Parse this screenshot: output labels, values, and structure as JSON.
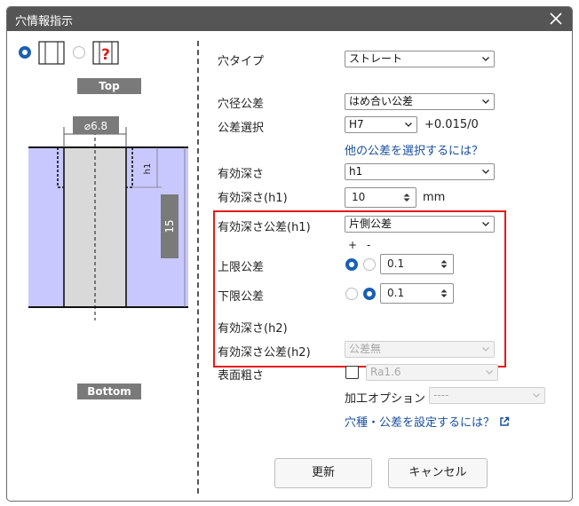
{
  "window": {
    "title": "穴情報指示"
  },
  "left": {
    "top_label": "Top",
    "bottom_label": "Bottom",
    "diagram": {
      "diameter": "⌀6.8",
      "depth_label": "h1",
      "depth_value": "15"
    }
  },
  "form": {
    "hole_type": {
      "label": "穴タイプ",
      "value": "ストレート"
    },
    "dia_tol": {
      "label": "穴径公差",
      "value": "はめ合い公差"
    },
    "tol_select": {
      "label": "公差選択",
      "value": "H7",
      "range": "+0.015/0"
    },
    "other_tol_link": "他の公差を選択するには？",
    "eff_depth": {
      "label": "有効深さ",
      "value": "h1"
    },
    "eff_depth_h1": {
      "label": "有効深さ(h1)",
      "value": "10",
      "unit": "mm"
    },
    "eff_depth_tol_h1": {
      "label": "有効深さ公差(h1)",
      "value": "片側公差"
    },
    "sign_plus": "+",
    "sign_minus": "-",
    "upper_tol": {
      "label": "上限公差",
      "value": "0.1"
    },
    "lower_tol": {
      "label": "下限公差",
      "value": "0.1"
    },
    "eff_depth_h2": {
      "label": "有効深さ(h2)"
    },
    "eff_depth_tol_h2": {
      "label": "有効深さ公差(h2)",
      "value": "公差無"
    },
    "surface": {
      "label": "表面粗さ",
      "value": "Ra1.6"
    },
    "process_option": {
      "label": "加工オプション",
      "value": "----"
    },
    "settings_link": "穴種・公差を設定するには？"
  },
  "buttons": {
    "update": "更新",
    "cancel": "キャンセル"
  },
  "colors": {
    "accent": "#1a5fb4",
    "highlight": "#e41b17",
    "titlebar": "#555555",
    "material": "#c8c8ff",
    "hole": "#d9d9d9"
  }
}
